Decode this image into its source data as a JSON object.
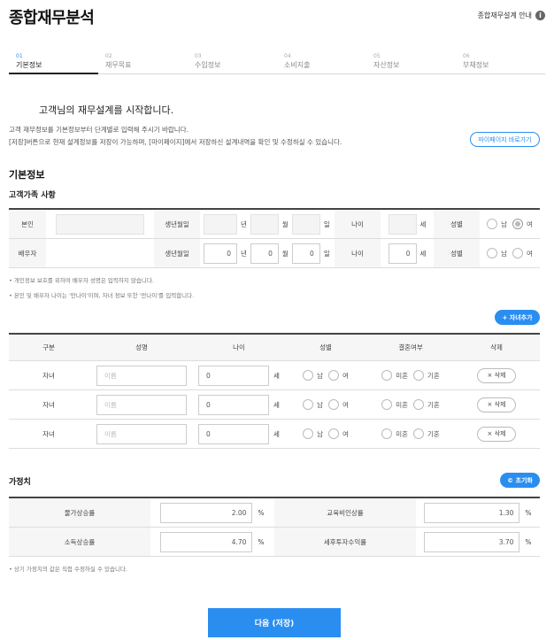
{
  "header": {
    "title": "종합재무분석",
    "guide": "종합재무설계 안내"
  },
  "steps": [
    {
      "num": "01",
      "label": "기본정보"
    },
    {
      "num": "02",
      "label": "재무목표"
    },
    {
      "num": "03",
      "label": "수입정보"
    },
    {
      "num": "04",
      "label": "소비지출"
    },
    {
      "num": "05",
      "label": "자산정보"
    },
    {
      "num": "06",
      "label": "부채정보"
    }
  ],
  "intro": {
    "title": "고객님의 재무설계를 시작합니다.",
    "line1": "고객 재무정보를 기본정보부터 단계별로 입력해 주시기 바랍니다.",
    "line2": "[저장]버튼으로 현재 설계정보를 저장이 가능하며, [마이페이지]에서 저장하신 설계내역을 확인 및 수정하실 수 있습니다.",
    "mypage_btn": "마이페이지 바로가기"
  },
  "basic": {
    "title": "기본정보",
    "family_title": "고객가족 사항",
    "labels": {
      "self": "본인",
      "spouse": "배우자",
      "birth": "생년월일",
      "year": "년",
      "month": "월",
      "day": "일",
      "age": "나이",
      "age_unit": "세",
      "gender": "성별",
      "male": "남",
      "female": "여"
    },
    "spouse_values": {
      "year": "0",
      "month": "0",
      "day": "0",
      "age": "0"
    },
    "notes": [
      "• 개인정보 보호를 위하여 배우자 성명은 입력하지 않습니다.",
      "• 본인 및 배우자 나이는 '만나이'이며, 자녀 정보 또한 '만나이'를 입력합니다."
    ],
    "add_child_btn": "+ 자녀추가"
  },
  "children": {
    "headers": [
      "구분",
      "성명",
      "나이",
      "성별",
      "결혼여부",
      "삭제"
    ],
    "rows": [
      {
        "type": "자녀",
        "name_placeholder": "이름",
        "age": "0"
      },
      {
        "type": "자녀",
        "name_placeholder": "이름",
        "age": "0"
      },
      {
        "type": "자녀",
        "name_placeholder": "이름",
        "age": "0"
      }
    ],
    "labels": {
      "age_unit": "세",
      "male": "남",
      "female": "여",
      "single": "미혼",
      "married": "기혼",
      "delete": "× 삭제"
    }
  },
  "assumptions": {
    "title": "가정치",
    "reset_btn": "© 초기화",
    "rows": [
      {
        "label_a": "물가상승률",
        "value_a": "2.00",
        "label_b": "교육비인상률",
        "value_b": "1.30"
      },
      {
        "label_a": "소득상승률",
        "value_a": "4.70",
        "label_b": "세후투자수익률",
        "value_b": "3.70"
      }
    ],
    "unit": "%",
    "note": "• 상기 가정치의 값은 직접 수정하실 수 있습니다."
  },
  "next_btn": "다음 (저장)"
}
